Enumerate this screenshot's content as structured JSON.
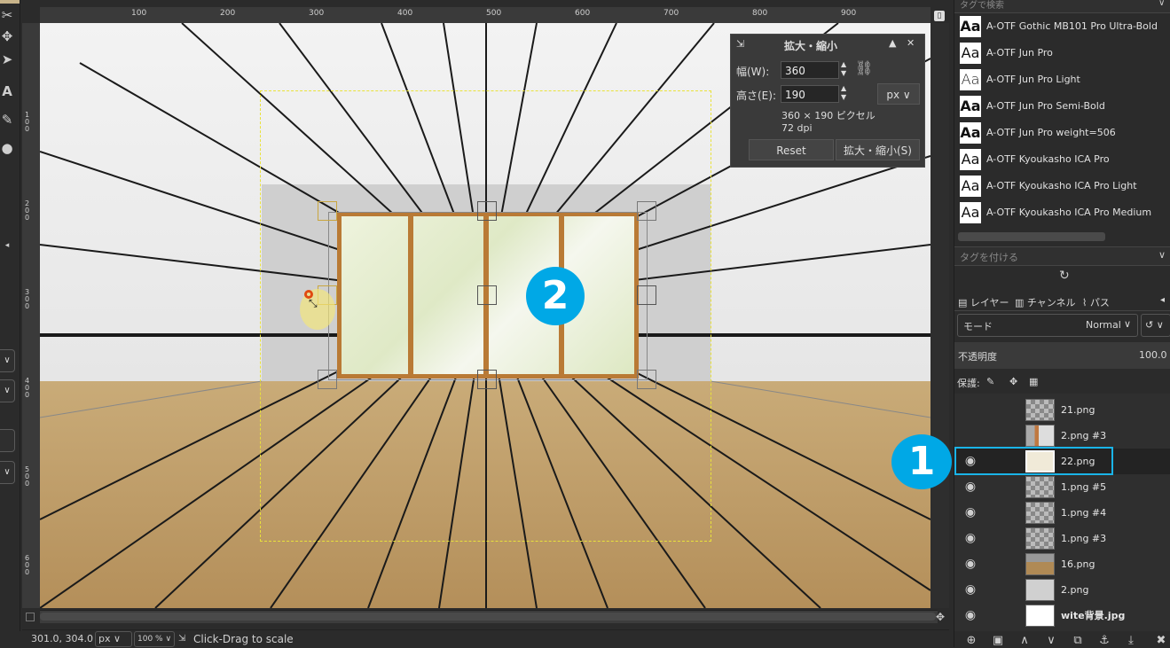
{
  "ruler": {
    "top": [
      "100",
      "200",
      "300",
      "400",
      "500",
      "600",
      "700",
      "800",
      "900"
    ],
    "left": [
      "100",
      "200",
      "300",
      "400",
      "500",
      "600"
    ]
  },
  "toolbox": {
    "dropdown_glyph": "∨"
  },
  "scale_dialog": {
    "title": "拡大・縮小",
    "width_label": "幅(W):",
    "width_value": "360",
    "height_label": "高さ(E):",
    "height_value": "190",
    "unit": "px",
    "size_info": "360 × 190 ピクセル",
    "dpi_info": "72 dpi",
    "reset_label": "Reset",
    "scale_label": "拡大・縮小(S)"
  },
  "canvas": {
    "badge_2": "2"
  },
  "status": {
    "coords": "301.0, 304.0",
    "unit": "px",
    "zoom": "100 %",
    "message": "Click-Drag to scale"
  },
  "fonts": {
    "tag_search_placeholder": "タグで検索",
    "tag_attach_placeholder": "タグを付ける",
    "preview_glyph": "Aa",
    "items": [
      {
        "name": "A-OTF Gothic MB101 Pro Ultra-Bold"
      },
      {
        "name": "A-OTF Jun Pro"
      },
      {
        "name": "A-OTF Jun Pro Light"
      },
      {
        "name": "A-OTF Jun Pro Semi-Bold"
      },
      {
        "name": "A-OTF Jun Pro weight=506"
      },
      {
        "name": "A-OTF Kyoukasho ICA Pro"
      },
      {
        "name": "A-OTF Kyoukasho ICA Pro Light"
      },
      {
        "name": "A-OTF Kyoukasho ICA Pro Medium"
      }
    ]
  },
  "layers_panel": {
    "tabs": [
      {
        "label": "レイヤー"
      },
      {
        "label": "チャンネル"
      },
      {
        "label": "パス"
      }
    ],
    "mode_label": "モード",
    "mode_value": "Normal",
    "opacity_label": "不透明度",
    "opacity_value": "100.0",
    "lock_label": "保護:",
    "badge_1": "1",
    "layers": [
      {
        "name": "21.png",
        "visible": false
      },
      {
        "name": "2.png #3",
        "visible": false
      },
      {
        "name": "22.png",
        "visible": true,
        "selected": true
      },
      {
        "name": "1.png #5",
        "visible": true
      },
      {
        "name": "1.png #4",
        "visible": true
      },
      {
        "name": "1.png #3",
        "visible": true
      },
      {
        "name": "16.png",
        "visible": true
      },
      {
        "name": "2.png",
        "visible": true
      },
      {
        "name": "wite背景.jpg",
        "visible": true
      }
    ]
  },
  "colors": {
    "accent_badge": "#00a8e6",
    "window_frame": "#b97a35",
    "selection_marquee": "#e9e23a",
    "layer_highlight": "#1ab4e8"
  }
}
